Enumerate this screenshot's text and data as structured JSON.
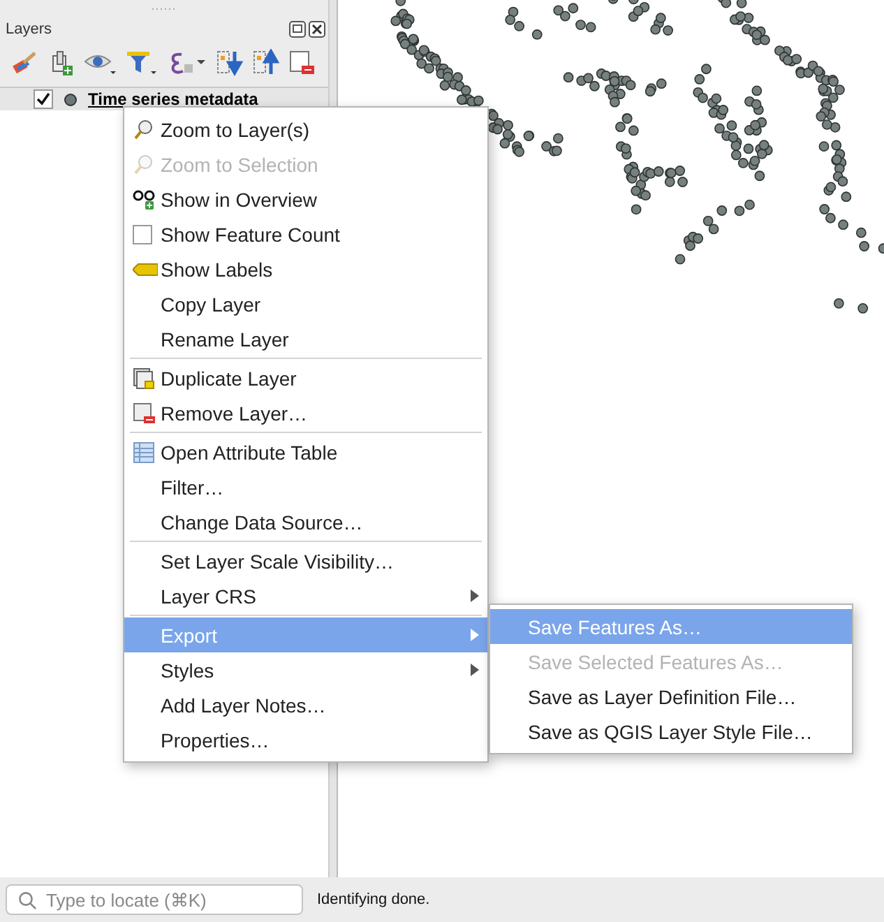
{
  "layers_panel": {
    "title": "Layers",
    "layers": [
      {
        "name": "Time series metadata",
        "checked": true
      }
    ]
  },
  "context_menu": {
    "groups": [
      [
        {
          "kind": "action",
          "label": "Zoom to Layer(s)",
          "disabled": false,
          "selected": false
        },
        {
          "kind": "action",
          "label": "Zoom to Selection",
          "disabled": true,
          "selected": false
        },
        {
          "kind": "action",
          "label": "Show in Overview",
          "disabled": false,
          "selected": false
        },
        {
          "kind": "checkbox",
          "label": "Show Feature Count",
          "checked": false,
          "disabled": false,
          "selected": false
        },
        {
          "kind": "action",
          "label": "Show Labels",
          "disabled": false,
          "selected": false
        },
        {
          "kind": "action",
          "label": "Copy Layer",
          "disabled": false,
          "selected": false
        },
        {
          "kind": "action",
          "label": "Rename Layer",
          "disabled": false,
          "selected": false
        }
      ],
      [
        {
          "kind": "action",
          "label": "Duplicate Layer",
          "disabled": false,
          "selected": false
        },
        {
          "kind": "action",
          "label": "Remove Layer…",
          "disabled": false,
          "selected": false
        }
      ],
      [
        {
          "kind": "action",
          "label": "Open Attribute Table",
          "disabled": false,
          "selected": false
        },
        {
          "kind": "action",
          "label": "Filter…",
          "disabled": false,
          "selected": false
        },
        {
          "kind": "action",
          "label": "Change Data Source…",
          "disabled": false,
          "selected": false
        }
      ],
      [
        {
          "kind": "action",
          "label": "Set Layer Scale Visibility…",
          "disabled": false,
          "selected": false
        },
        {
          "kind": "submenu",
          "label": "Layer CRS",
          "disabled": false,
          "selected": false
        }
      ],
      [
        {
          "kind": "submenu",
          "label": "Export",
          "disabled": false,
          "selected": true
        },
        {
          "kind": "submenu",
          "label": "Styles",
          "disabled": false,
          "selected": false
        },
        {
          "kind": "action",
          "label": "Add Layer Notes…",
          "disabled": false,
          "selected": false
        },
        {
          "kind": "action",
          "label": "Properties…",
          "disabled": false,
          "selected": false
        }
      ]
    ]
  },
  "export_submenu": {
    "items": [
      {
        "label": "Save Features As…",
        "disabled": false,
        "selected": true
      },
      {
        "label": "Save Selected Features As…",
        "disabled": true,
        "selected": false
      },
      {
        "label": "Save as Layer Definition File…",
        "disabled": false,
        "selected": false
      },
      {
        "label": "Save as QGIS Layer Style File…",
        "disabled": false,
        "selected": false
      }
    ]
  },
  "status_bar": {
    "locator": {
      "placeholder": "Type to locate (⌘K)"
    },
    "message": "Identifying done."
  }
}
